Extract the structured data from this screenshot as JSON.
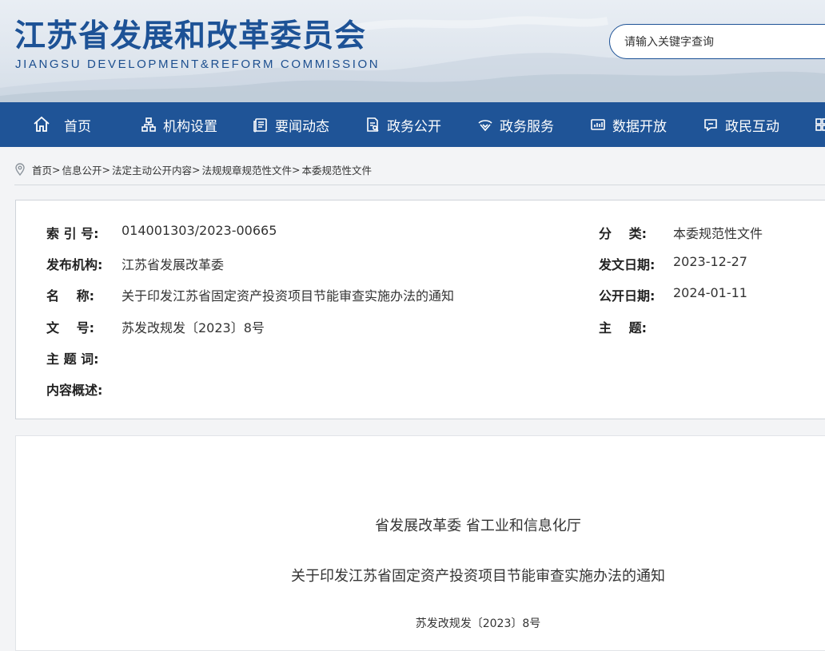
{
  "header": {
    "title": "江苏省发展和改革委员会",
    "subtitle": "JIANGSU DEVELOPMENT&REFORM COMMISSION",
    "search_placeholder": "请输入关键字查询"
  },
  "nav": {
    "items": [
      {
        "label": "首页",
        "icon": "home-icon"
      },
      {
        "label": "机构设置",
        "icon": "org-chart-icon"
      },
      {
        "label": "要闻动态",
        "icon": "news-icon"
      },
      {
        "label": "政务公开",
        "icon": "document-icon"
      },
      {
        "label": "政务服务",
        "icon": "service-icon"
      },
      {
        "label": "数据开放",
        "icon": "data-chart-icon"
      },
      {
        "label": "政民互动",
        "icon": "chat-icon"
      }
    ]
  },
  "breadcrumb": {
    "items": [
      "首页",
      "信息公开",
      "法定主动公开内容",
      "法规规章规范性文件",
      "本委规范性文件"
    ],
    "separator": ">"
  },
  "info": {
    "index_label": "索 引 号:",
    "index_value": "014001303/2023-00665",
    "category_label": "分　 类:",
    "category_value": "本委规范性文件",
    "publisher_label": "发布机构:",
    "publisher_value": "江苏省发展改革委",
    "issue_date_label": "发文日期:",
    "issue_date_value": "2023-12-27",
    "name_label": "名　 称:",
    "name_value": "关于印发江苏省固定资产投资项目节能审查实施办法的通知",
    "public_date_label": "公开日期:",
    "public_date_value": "2024-01-11",
    "doc_no_label": "文　 号:",
    "doc_no_value": "苏发改规发〔2023〕8号",
    "subject_label": "主　 题:",
    "keywords_label": "主 题 词:",
    "summary_label": "内容概述:"
  },
  "document": {
    "issuers": "省发展改革委  省工业和信息化厅",
    "title": "关于印发江苏省固定资产投资项目节能审查实施办法的通知",
    "doc_no": "苏发改规发〔2023〕8号"
  },
  "colors": {
    "brand_blue": "#1f5497",
    "title_blue": "#1d5296"
  }
}
